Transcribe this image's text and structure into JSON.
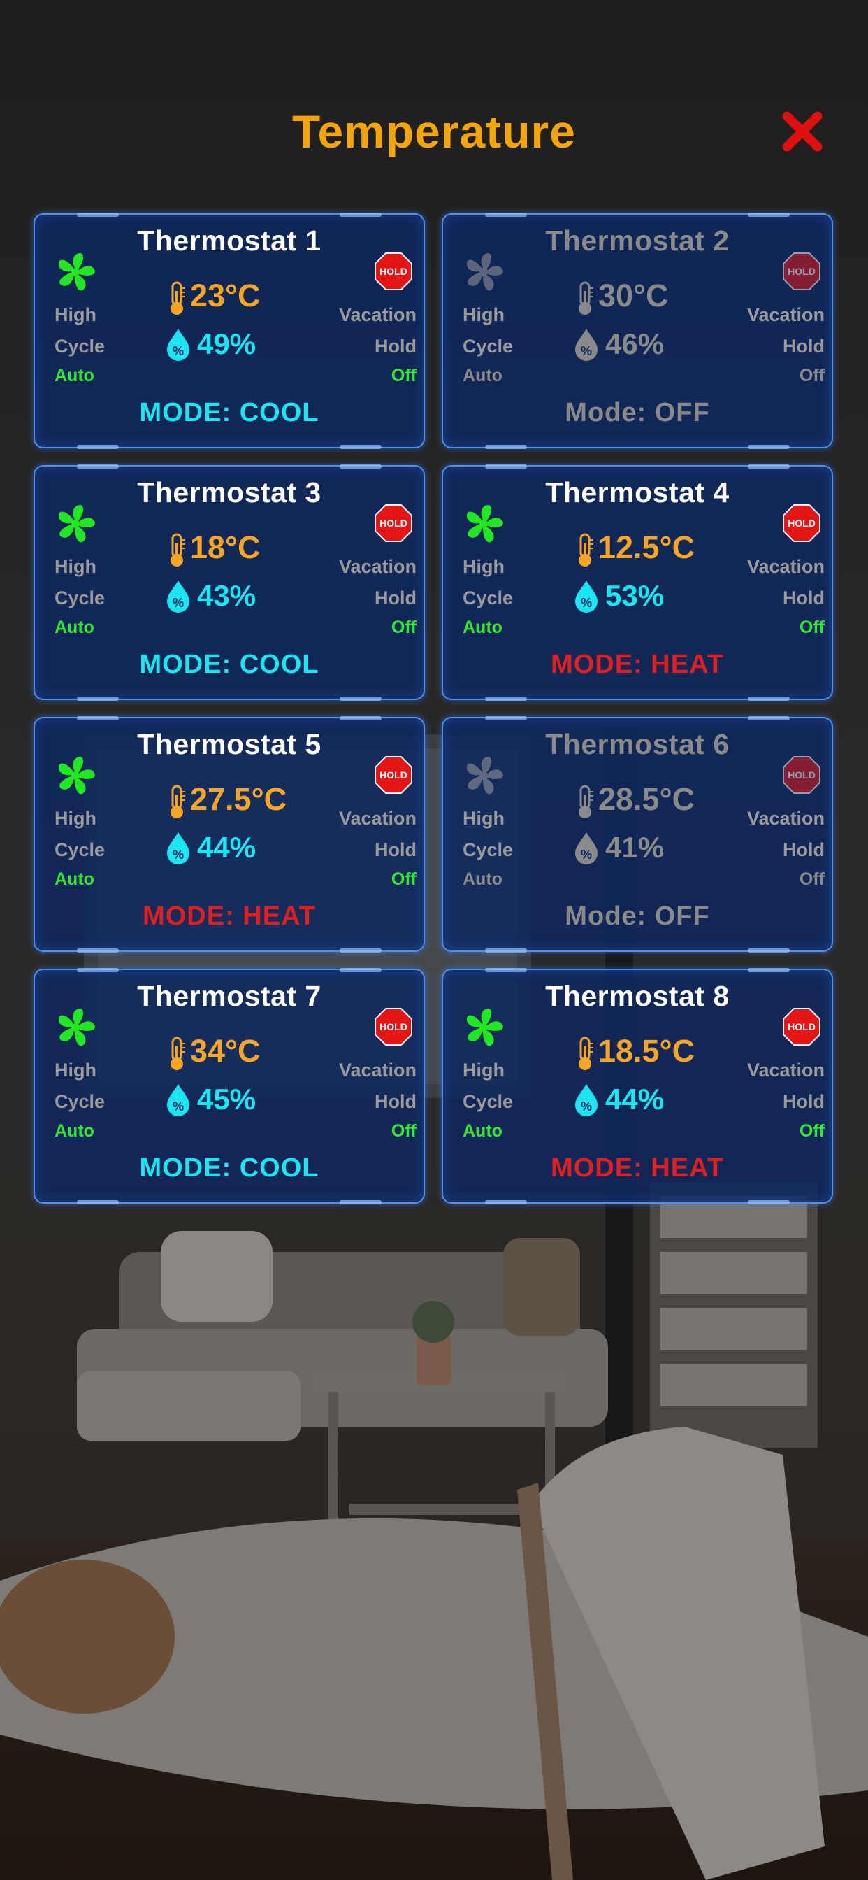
{
  "header": {
    "title": "Temperature"
  },
  "labels": {
    "high": "High",
    "cycle": "Cycle",
    "auto": "Auto",
    "vacation": "Vacation",
    "hold": "Hold",
    "off": "Off",
    "hold_badge": "HOLD"
  },
  "colors": {
    "title": "#f5a500",
    "close": "#e01010",
    "fan_on": "#21e821",
    "fan_off": "#9a9a9a",
    "temperature": "#f6a623",
    "humidity": "#18e6f0",
    "mode_cool": "#18e6f0",
    "mode_heat": "#e01f1f",
    "mode_off": "#8a8a8a"
  },
  "thermostats": [
    {
      "name": "Thermostat 1",
      "temp": "23°C",
      "humidity": "49%",
      "mode": "MODE: COOL",
      "state": "cool",
      "active": true
    },
    {
      "name": "Thermostat 2",
      "temp": "30°C",
      "humidity": "46%",
      "mode": "Mode: OFF",
      "state": "off",
      "active": false
    },
    {
      "name": "Thermostat 3",
      "temp": "18°C",
      "humidity": "43%",
      "mode": "MODE: COOL",
      "state": "cool",
      "active": true
    },
    {
      "name": "Thermostat 4",
      "temp": "12.5°C",
      "humidity": "53%",
      "mode": "MODE: HEAT",
      "state": "heat",
      "active": true
    },
    {
      "name": "Thermostat 5",
      "temp": "27.5°C",
      "humidity": "44%",
      "mode": "MODE: HEAT",
      "state": "heat",
      "active": true
    },
    {
      "name": "Thermostat 6",
      "temp": "28.5°C",
      "humidity": "41%",
      "mode": "Mode: OFF",
      "state": "off",
      "active": false
    },
    {
      "name": "Thermostat 7",
      "temp": "34°C",
      "humidity": "45%",
      "mode": "MODE: COOL",
      "state": "cool",
      "active": true
    },
    {
      "name": "Thermostat 8",
      "temp": "18.5°C",
      "humidity": "44%",
      "mode": "MODE: HEAT",
      "state": "heat",
      "active": true
    }
  ]
}
